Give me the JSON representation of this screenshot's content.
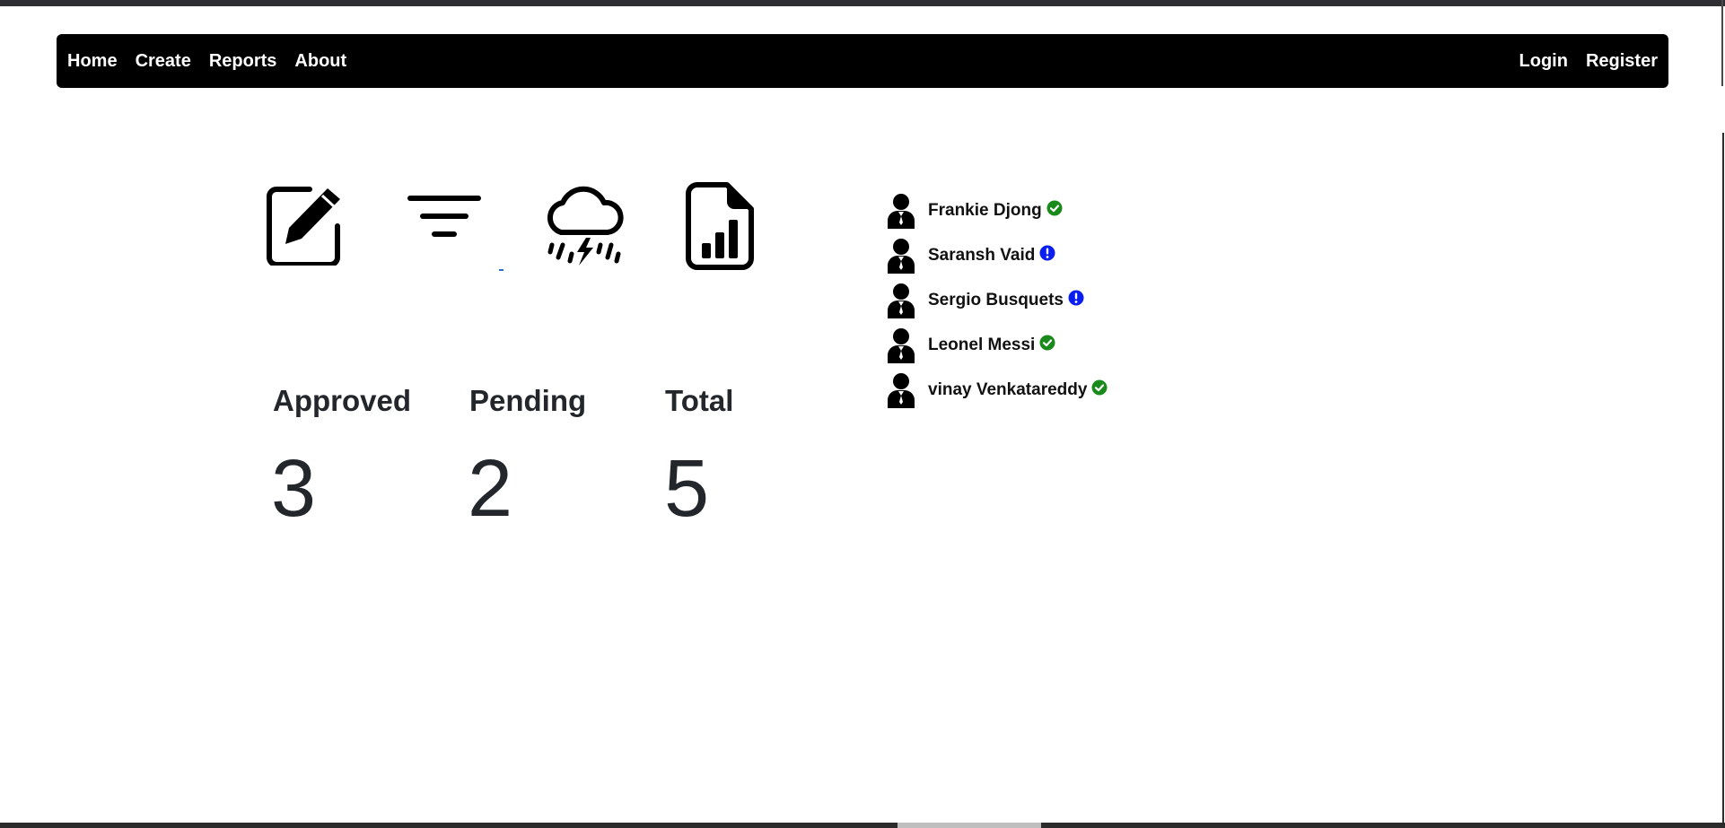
{
  "nav": {
    "left": [
      {
        "label": "Home"
      },
      {
        "label": "Create"
      },
      {
        "label": "Reports"
      },
      {
        "label": "About"
      }
    ],
    "right": [
      {
        "label": "Login"
      },
      {
        "label": "Register"
      }
    ]
  },
  "actions": [
    {
      "icon": "edit-icon"
    },
    {
      "icon": "filter-icon"
    },
    {
      "icon": "cloud-lightning-rain-icon"
    },
    {
      "icon": "file-bar-chart-icon"
    }
  ],
  "stats": {
    "approved": {
      "label": "Approved",
      "value": "3"
    },
    "pending": {
      "label": "Pending",
      "value": "2"
    },
    "total": {
      "label": "Total",
      "value": "5"
    }
  },
  "users": [
    {
      "name": "Frankie Djong",
      "status": "approved",
      "status_icon": "check-circle-icon",
      "color": "#1a8a1a"
    },
    {
      "name": "Saransh Vaid",
      "status": "pending",
      "status_icon": "exclamation-circle-icon",
      "color": "#0a1ef0"
    },
    {
      "name": "Sergio Busquets",
      "status": "pending",
      "status_icon": "exclamation-circle-icon",
      "color": "#0a1ef0"
    },
    {
      "name": "Leonel Messi",
      "status": "approved",
      "status_icon": "check-circle-icon",
      "color": "#1a8a1a"
    },
    {
      "name": "vinay Venkatareddy",
      "status": "approved",
      "status_icon": "check-circle-icon",
      "color": "#1a8a1a"
    }
  ],
  "colors": {
    "navbar": "#000000",
    "text": "#23262b",
    "approved": "#1a8a1a",
    "pending": "#0a1ef0"
  }
}
